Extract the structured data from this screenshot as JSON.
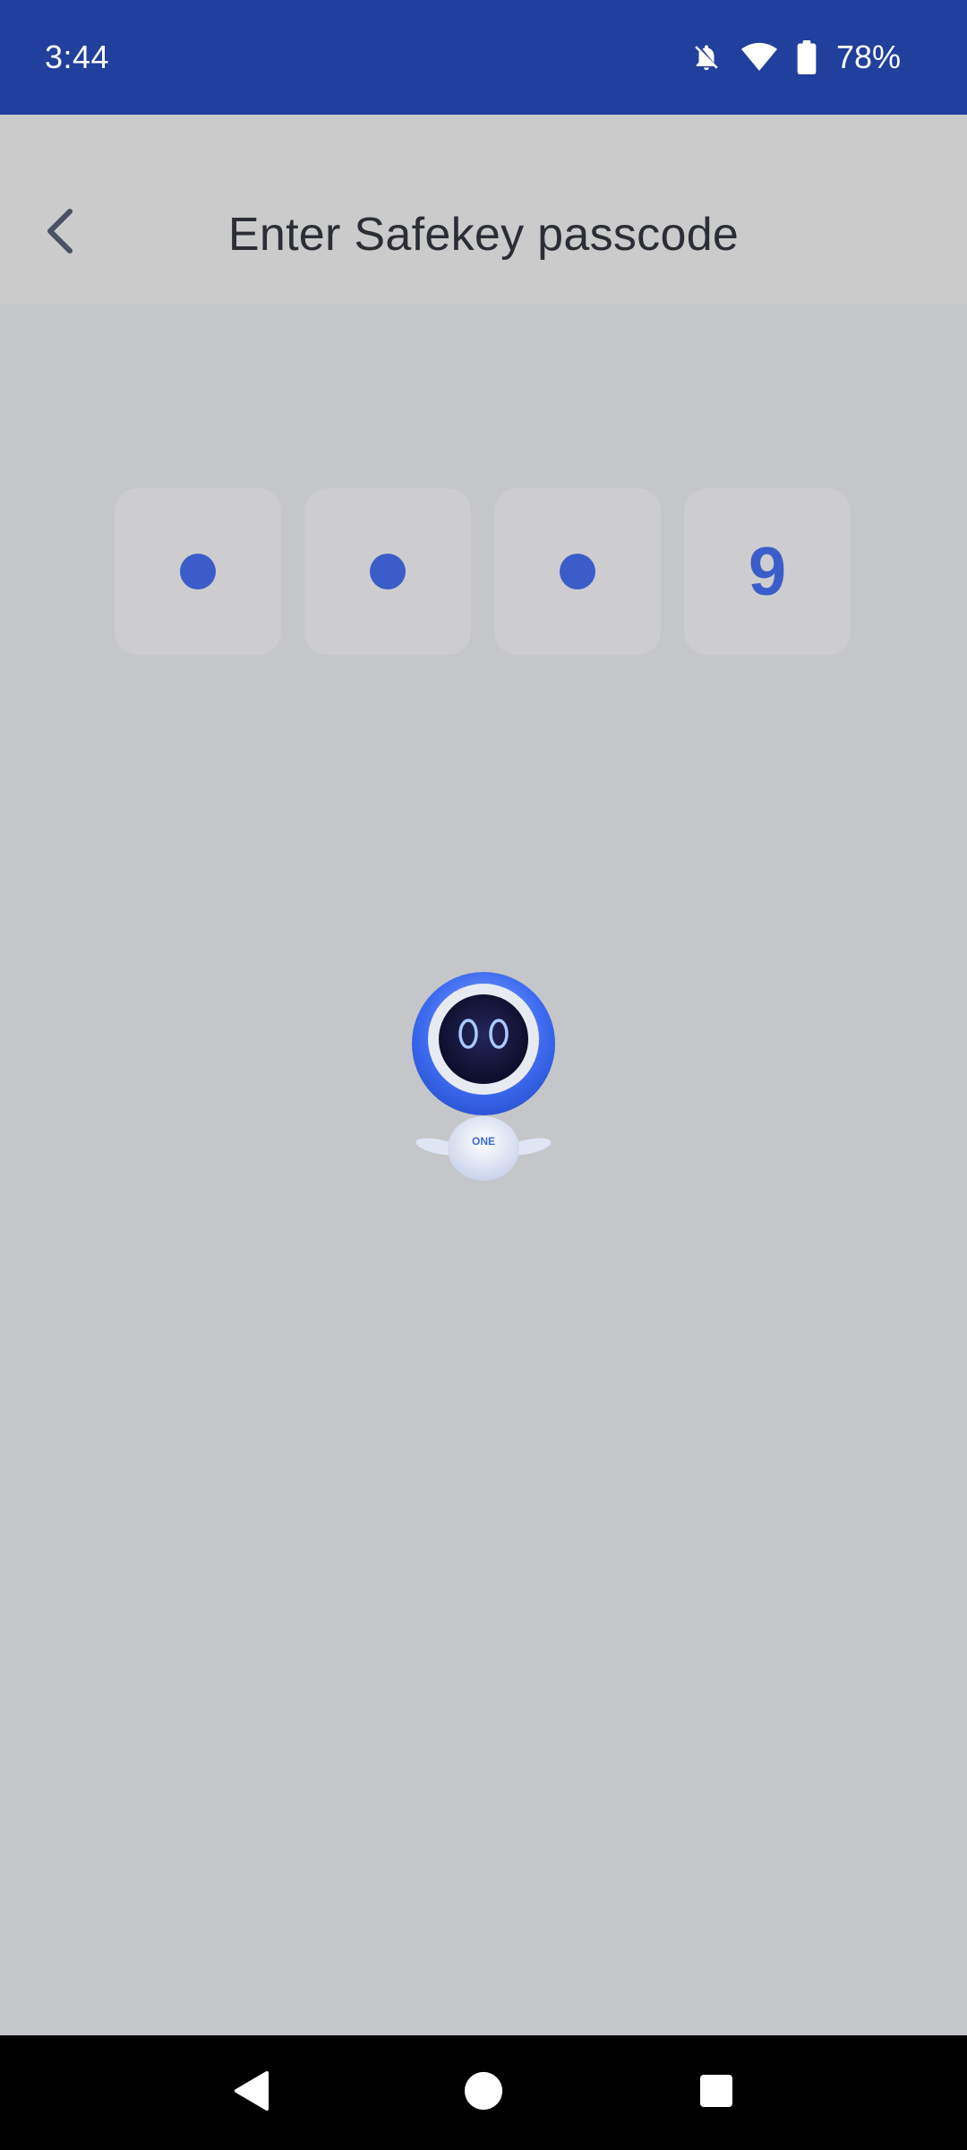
{
  "status_bar": {
    "time": "3:44",
    "battery_percent": "78%",
    "icons": [
      "notifications-off-icon",
      "wifi-icon",
      "battery-icon"
    ]
  },
  "header": {
    "title": "Enter Safekey passcode",
    "back_icon": "chevron-left-icon"
  },
  "passcode": {
    "length": 4,
    "entered_count": 4,
    "last_visible_digit": "9"
  },
  "mascot": {
    "badge_text": "ONE"
  },
  "nav_bar": {
    "icons": [
      "back-triangle-icon",
      "home-circle-icon",
      "recents-square-icon"
    ]
  },
  "colors": {
    "status_bar_bg": "#213f9c",
    "accent": "#3a5dc9",
    "background": "#c5c6c9",
    "header_bg": "#cbcbcc"
  }
}
